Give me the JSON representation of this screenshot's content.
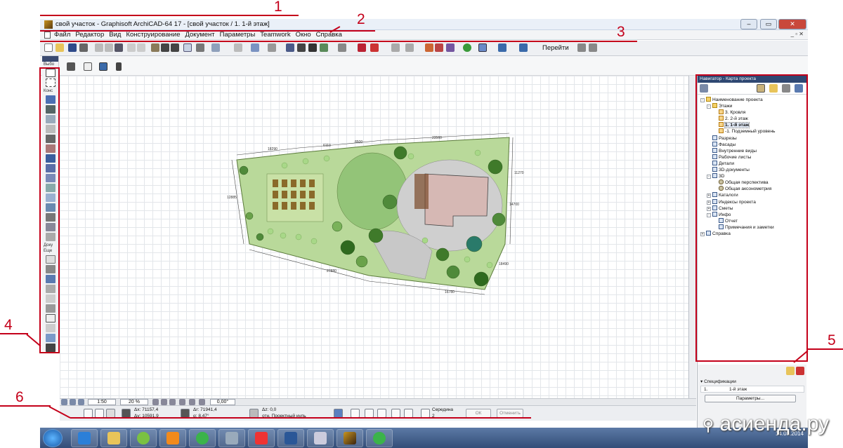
{
  "window": {
    "title": "свой участок - Graphisoft ArchiCAD-64 17 - [свой участок / 1. 1-й этаж]"
  },
  "menu": {
    "items": [
      "Файл",
      "Редактор",
      "Вид",
      "Конструирование",
      "Документ",
      "Параметры",
      "Teamwork",
      "Окно",
      "Справка"
    ]
  },
  "toolbar": {
    "goto_label": "Перейти"
  },
  "toolbox": {
    "select_label": "Выбо",
    "construct_label": "Конс",
    "document_label": "Доку",
    "more_label": "Еще"
  },
  "plan": {
    "dimensions": [
      "18290",
      "6110",
      "8500",
      "23560",
      "11270",
      "12885",
      "14700",
      "18490",
      "27880",
      "16780"
    ]
  },
  "canvas_bottom": {
    "scale": "1:50",
    "zoom": "20 %",
    "angle": "0,00°"
  },
  "coords": {
    "dx": "Δx: 71157,4",
    "dy": "Δy: 10591,9",
    "dr": "Δr: 71941,4",
    "da": "α: 8,47°",
    "dz": "Δz: 0,0",
    "zero": "отн. Проектный нуль",
    "mode": "Середина",
    "mode_val": "2",
    "ok": "ОК",
    "cancel": "Отменить"
  },
  "navigator": {
    "title": "Навигатор - Карта проекта",
    "tree": [
      {
        "label": "Наименование проекта",
        "level": 0,
        "icon": "folder",
        "pm": "-"
      },
      {
        "label": "Этажи",
        "level": 1,
        "icon": "folder",
        "pm": "-"
      },
      {
        "label": "3. Кровля",
        "level": 2,
        "icon": "story",
        "pm": ""
      },
      {
        "label": "2. 2-й этаж",
        "level": 2,
        "icon": "story",
        "pm": ""
      },
      {
        "label": "1. 1-й этаж",
        "level": 2,
        "icon": "story",
        "pm": "",
        "current": true
      },
      {
        "label": "-1. Подземный уровень",
        "level": 2,
        "icon": "story",
        "pm": ""
      },
      {
        "label": "Разрезы",
        "level": 1,
        "icon": "view",
        "pm": ""
      },
      {
        "label": "Фасады",
        "level": 1,
        "icon": "view",
        "pm": ""
      },
      {
        "label": "Внутренние виды",
        "level": 1,
        "icon": "view",
        "pm": ""
      },
      {
        "label": "Рабочие листы",
        "level": 1,
        "icon": "view",
        "pm": ""
      },
      {
        "label": "Детали",
        "level": 1,
        "icon": "view",
        "pm": ""
      },
      {
        "label": "3D-документы",
        "level": 1,
        "icon": "view",
        "pm": ""
      },
      {
        "label": "3D",
        "level": 1,
        "icon": "view",
        "pm": "-"
      },
      {
        "label": "Общая перспектива",
        "level": 2,
        "icon": "cam",
        "pm": ""
      },
      {
        "label": "Общая аксонометрия",
        "level": 2,
        "icon": "cam",
        "pm": ""
      },
      {
        "label": "Каталоги",
        "level": 1,
        "icon": "view",
        "pm": "+"
      },
      {
        "label": "Индексы проекта",
        "level": 1,
        "icon": "view",
        "pm": "+"
      },
      {
        "label": "Сметы",
        "level": 1,
        "icon": "view",
        "pm": "+"
      },
      {
        "label": "Инфо",
        "level": 1,
        "icon": "view",
        "pm": "-"
      },
      {
        "label": "Отчет",
        "level": 2,
        "icon": "view",
        "pm": ""
      },
      {
        "label": "Примечания и заметки",
        "level": 2,
        "icon": "view",
        "pm": ""
      },
      {
        "label": "Справка",
        "level": 0,
        "icon": "view",
        "pm": "+"
      }
    ]
  },
  "spec": {
    "header": "Спецификации",
    "row_num": "1.",
    "row_name": "1-й этаж",
    "params_button": "Параметры..."
  },
  "taskbar": {
    "date": "14.03.2014"
  },
  "annotations": [
    "1",
    "2",
    "3",
    "4",
    "5",
    "6"
  ],
  "watermark": "асиенда.ру",
  "colors": {
    "annotation": "#c4001a",
    "navigator_title": "#2f4872",
    "lawn": "#8fbf6a",
    "paving": "#c9c9c9",
    "house": "#d6b8b4"
  }
}
